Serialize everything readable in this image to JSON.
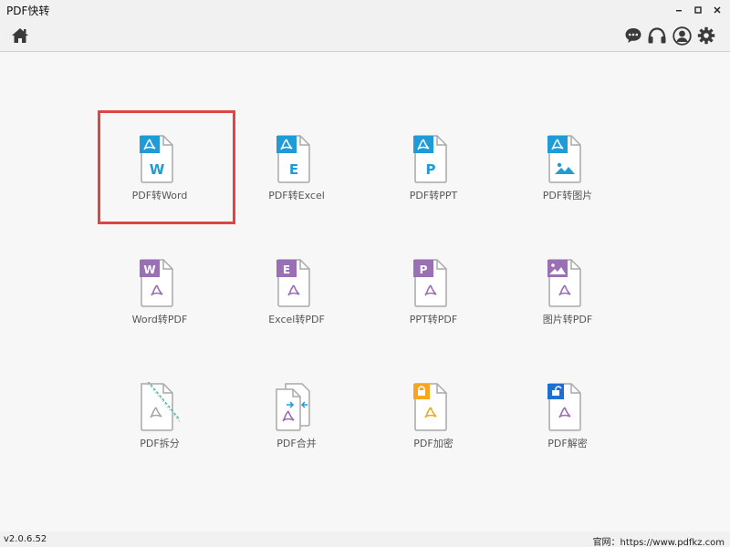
{
  "app": {
    "title": "PDF快转"
  },
  "window_controls": {
    "minimize_icon": "minimize-icon",
    "maximize_icon": "maximize-icon",
    "close_icon": "close-icon"
  },
  "toolbar": {
    "home_icon": "home-icon",
    "right_icons": [
      "chat-icon",
      "headset-icon",
      "user-icon",
      "gear-icon"
    ]
  },
  "tools": [
    {
      "label": "PDF转Word",
      "icon": "pdf-to-word-icon"
    },
    {
      "label": "PDF转Excel",
      "icon": "pdf-to-excel-icon"
    },
    {
      "label": "PDF转PPT",
      "icon": "pdf-to-ppt-icon"
    },
    {
      "label": "PDF转图片",
      "icon": "pdf-to-image-icon"
    },
    {
      "label": "Word转PDF",
      "icon": "word-to-pdf-icon"
    },
    {
      "label": "Excel转PDF",
      "icon": "excel-to-pdf-icon"
    },
    {
      "label": "PPT转PDF",
      "icon": "ppt-to-pdf-icon"
    },
    {
      "label": "图片转PDF",
      "icon": "image-to-pdf-icon"
    },
    {
      "label": "PDF拆分",
      "icon": "pdf-split-icon"
    },
    {
      "label": "PDF合并",
      "icon": "pdf-merge-icon"
    },
    {
      "label": "PDF加密",
      "icon": "pdf-encrypt-icon"
    },
    {
      "label": "PDF解密",
      "icon": "pdf-decrypt-icon"
    }
  ],
  "selected_tool": "PDF转Word",
  "status": {
    "version": "v2.0.6.52",
    "website": "官网：https://www.pdfkz.com"
  },
  "colors": {
    "blue": "#1f9bd7",
    "purple": "#9b6fb3",
    "orange": "#f5a623",
    "selection": "#e04545"
  }
}
